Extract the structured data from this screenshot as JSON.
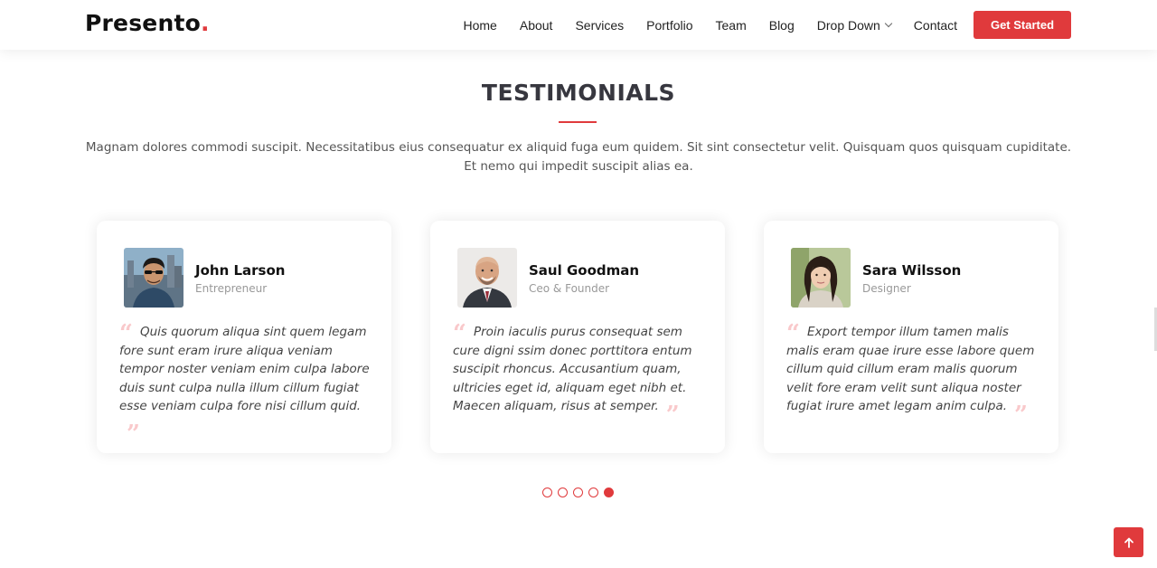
{
  "header": {
    "logo_text": "Presento",
    "logo_dot": ".",
    "nav": [
      {
        "label": "Home"
      },
      {
        "label": "About"
      },
      {
        "label": "Services"
      },
      {
        "label": "Portfolio"
      },
      {
        "label": "Team"
      },
      {
        "label": "Blog"
      },
      {
        "label": "Drop Down"
      },
      {
        "label": "Contact"
      }
    ],
    "cta_label": "Get Started"
  },
  "section": {
    "title": "TESTIMONIALS",
    "description": "Magnam dolores commodi suscipit. Necessitatibus eius consequatur ex aliquid fuga eum quidem. Sit sint consectetur velit. Quisquam quos quisquam cupiditate. Et nemo qui impedit suscipit alias ea."
  },
  "testimonials": [
    {
      "name": "John Larson",
      "role": "Entrepreneur",
      "quote": "Quis quorum aliqua sint quem legam fore sunt eram irure aliqua veniam tempor noster veniam enim culpa labore duis sunt culpa nulla illum cillum fugiat esse veniam culpa fore nisi cillum quid."
    },
    {
      "name": "Saul Goodman",
      "role": "Ceo & Founder",
      "quote": "Proin iaculis purus consequat sem cure digni ssim donec porttitora entum suscipit rhoncus. Accusantium quam, ultricies eget id, aliquam eget nibh et. Maecen aliquam, risus at semper."
    },
    {
      "name": "Sara Wilsson",
      "role": "Designer",
      "quote": "Export tempor illum tamen malis malis eram quae irure esse labore quem cillum quid cillum eram malis quorum velit fore eram velit sunt aliqua noster fugiat irure amet legam anim culpa."
    }
  ],
  "pagination": {
    "count": 5,
    "active_index": 4
  },
  "icons": {
    "quote_open": "“",
    "quote_close": "”",
    "back_to_top": "arrow-up-icon",
    "dropdown": "chevron-down-icon"
  },
  "colors": {
    "accent": "#e03a3c",
    "quote": "#f9c9cb"
  }
}
